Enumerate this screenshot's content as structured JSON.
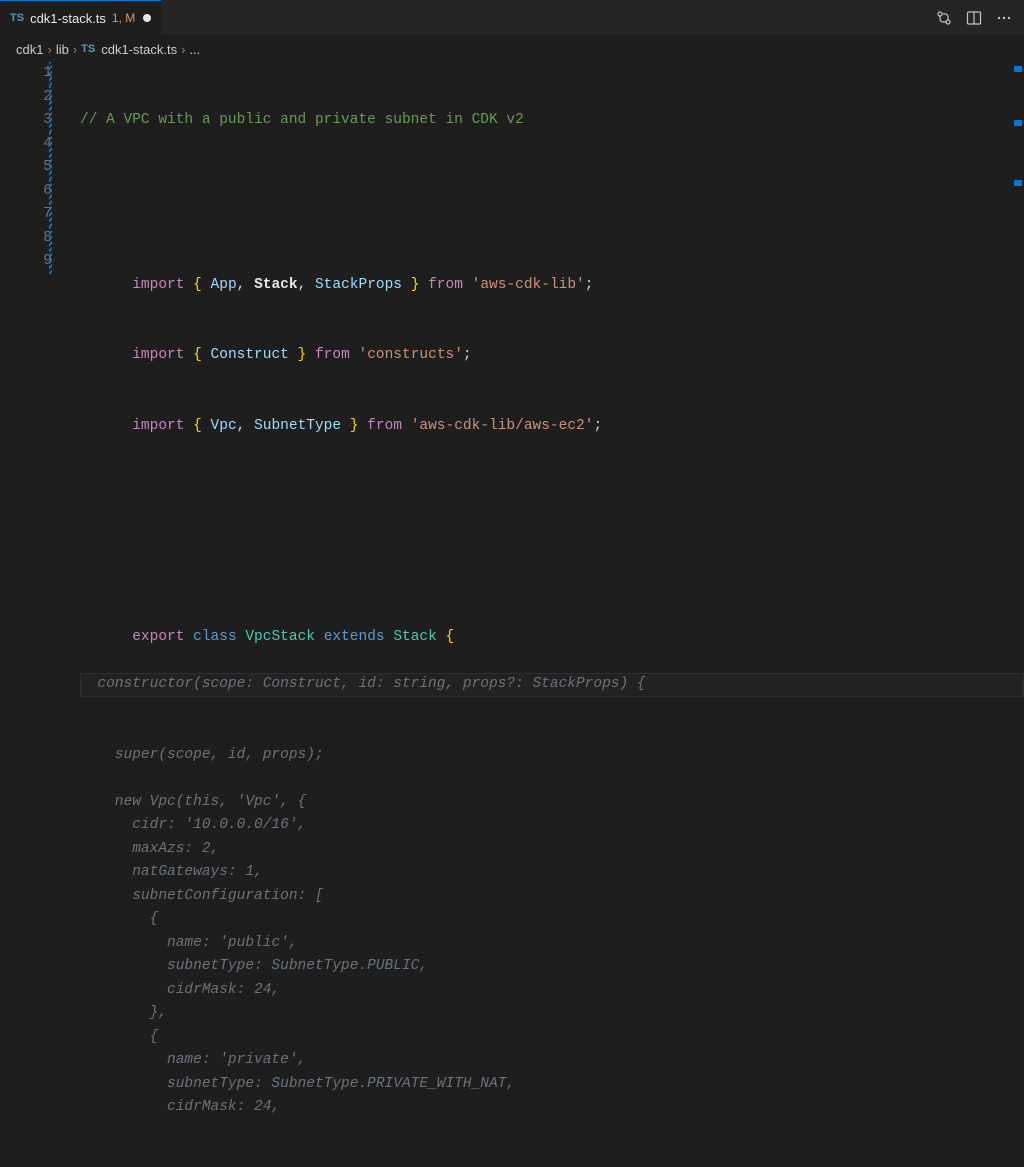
{
  "tab": {
    "icon_label": "TS",
    "filename": "cdk1-stack.ts",
    "modified_suffix": "1, M"
  },
  "breadcrumb": {
    "seg1": "cdk1",
    "seg2": "lib",
    "file_icon": "TS",
    "file": "cdk1-stack.ts",
    "trailing": "..."
  },
  "code": {
    "l1_comment": "// A VPC with a public and private subnet in CDK v2",
    "l3": {
      "imp": "import",
      "lb": "{ ",
      "n1": "App",
      "c": ", ",
      "n2": "Stack",
      "n3": "StackProps",
      "rb": " }",
      "from": " from ",
      "str": "'aws-cdk-lib'",
      "sc": ";"
    },
    "l4": {
      "imp": "import",
      "lb": "{ ",
      "n1": "Construct",
      "rb": " }",
      "from": " from ",
      "str": "'constructs'",
      "sc": ";"
    },
    "l5": {
      "imp": "import",
      "lb": "{ ",
      "n1": "Vpc",
      "n2": "SubnetType",
      "rb": " }",
      "from": " from ",
      "str": "'aws-cdk-lib/aws-ec2'",
      "sc": ";"
    },
    "l8": {
      "exp": "export",
      "cls": "class",
      "name": "VpcStack",
      "ext": "extends",
      "base": "Stack",
      "br": "{"
    },
    "l9_suggestion_first": "  constructor(scope: Construct, id: string, props?: StackProps) {",
    "suggestion_lines": [
      "    super(scope, id, props);",
      "",
      "    new Vpc(this, 'Vpc', {",
      "      cidr: '10.0.0.0/16',",
      "      maxAzs: 2,",
      "      natGateways: 1,",
      "      subnetConfiguration: [",
      "        {",
      "          name: 'public',",
      "          subnetType: SubnetType.PUBLIC,",
      "          cidrMask: 24,",
      "        },",
      "        {",
      "          name: 'private',",
      "          subnetType: SubnetType.PRIVATE_WITH_NAT,",
      "          cidrMask: 24,"
    ]
  },
  "gutter_numbers": [
    "1",
    "2",
    "3",
    "4",
    "5",
    "6",
    "7",
    "8",
    "9"
  ]
}
